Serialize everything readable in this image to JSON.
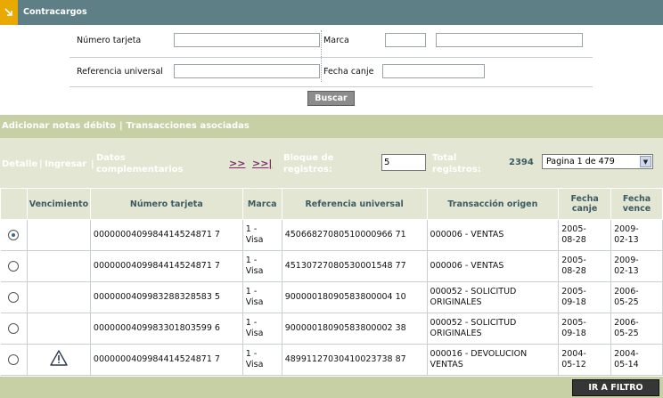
{
  "title": "Contracargos",
  "filter": {
    "numero_tarjeta_label": "Número tarjeta",
    "marca_label": "Marca",
    "referencia_label": "Referencia universal",
    "fecha_canje_label": "Fecha canje",
    "buscar_label": "Buscar"
  },
  "actions": {
    "adicionar": "Adicionar notas débito",
    "transacciones": "Transacciones asociadas"
  },
  "toolbar": {
    "detalle": "Detalle",
    "ingresar": "Ingresar",
    "datos_line1": "Datos",
    "datos_line2": "complementarios",
    "next": ">>",
    "last": ">>|",
    "bloque_line1": "Bloque de",
    "bloque_line2": "registros:",
    "bloque_value": "5",
    "total_line1": "Total",
    "total_line2": "registros:",
    "total_value": "2394",
    "pagina_value": "Pagina 1 de 479"
  },
  "table": {
    "headers": {
      "vencimiento": "Vencimiento",
      "numero": "Número tarjeta",
      "marca": "Marca",
      "referencia": "Referencia universal",
      "transaccion": "Transacción origen",
      "fecha_canje_1": "Fecha",
      "fecha_canje_2": "canje",
      "fecha_vence_1": "Fecha",
      "fecha_vence_2": "vence"
    },
    "rows": [
      {
        "selected": true,
        "warning": false,
        "numero": "0000000409984414524871 7",
        "marca_1": "1 -",
        "marca_2": "Visa",
        "referencia": "45066827080510000966 71",
        "trans_1": "000006 - VENTAS",
        "trans_2": "",
        "canje_1": "2005-",
        "canje_2": "08-28",
        "vence_1": "2009-",
        "vence_2": "02-13"
      },
      {
        "selected": false,
        "warning": false,
        "numero": "0000000409984414524871 7",
        "marca_1": "1 -",
        "marca_2": "Visa",
        "referencia": "45130727080530001548 77",
        "trans_1": "000006 - VENTAS",
        "trans_2": "",
        "canje_1": "2005-",
        "canje_2": "08-28",
        "vence_1": "2009-",
        "vence_2": "02-13"
      },
      {
        "selected": false,
        "warning": false,
        "numero": "0000000409983288328583 5",
        "marca_1": "1 -",
        "marca_2": "Visa",
        "referencia": "90000018090583800004 10",
        "trans_1": "000052 - SOLICITUD",
        "trans_2": "ORIGINALES",
        "canje_1": "2005-",
        "canje_2": "09-18",
        "vence_1": "2006-",
        "vence_2": "05-25"
      },
      {
        "selected": false,
        "warning": false,
        "numero": "0000000409983301803599 6",
        "marca_1": "1 -",
        "marca_2": "Visa",
        "referencia": "90000018090583800002 38",
        "trans_1": "000052 - SOLICITUD",
        "trans_2": "ORIGINALES",
        "canje_1": "2005-",
        "canje_2": "09-18",
        "vence_1": "2006-",
        "vence_2": "05-25"
      },
      {
        "selected": false,
        "warning": true,
        "numero": "0000000409984414524871 7",
        "marca_1": "1 -",
        "marca_2": "Visa",
        "referencia": "48991127030410023738 87",
        "trans_1": "000016 - DEVOLUCION",
        "trans_2": "VENTAS",
        "canje_1": "2004-",
        "canje_2": "05-12",
        "vence_1": "2004-",
        "vence_2": "05-14"
      }
    ]
  },
  "ir_filtro": "IR A FILTRO",
  "colors": {
    "titlebar": "#5f7f87",
    "accent": "#e9a900",
    "band": "#c7cfa4",
    "band_light": "#e3e6d2",
    "link": "#7a2b6f"
  }
}
